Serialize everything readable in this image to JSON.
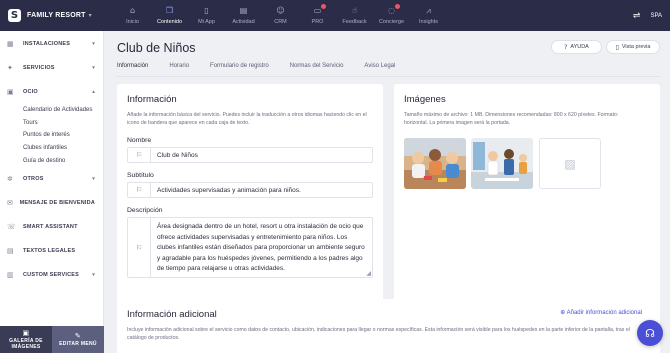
{
  "brand": {
    "name": "FAMILY RESORT",
    "logo_letter": "S"
  },
  "nav": [
    {
      "label": "Inicio",
      "icon": "home-icon",
      "glyph": "⌂",
      "badge": false,
      "active": false
    },
    {
      "label": "Contenido",
      "icon": "content-icon",
      "glyph": "❒",
      "badge": false,
      "active": true
    },
    {
      "label": "Mi App",
      "icon": "phone-icon",
      "glyph": "▯",
      "badge": false,
      "active": false
    },
    {
      "label": "Actividad",
      "icon": "activity-icon",
      "glyph": "▤",
      "badge": false,
      "active": false
    },
    {
      "label": "CRM",
      "icon": "users-icon",
      "glyph": "☺",
      "badge": false,
      "active": false
    },
    {
      "label": "PRO",
      "icon": "pro-icon",
      "glyph": "▭",
      "badge": true,
      "active": false
    },
    {
      "label": "Feedback",
      "icon": "thumbs-up-icon",
      "glyph": "☝",
      "badge": false,
      "active": false
    },
    {
      "label": "Concierge",
      "icon": "chat-icon",
      "glyph": "◌",
      "badge": true,
      "active": false
    },
    {
      "label": "Insights",
      "icon": "chart-icon",
      "glyph": "⩘",
      "badge": false,
      "active": false
    }
  ],
  "topright": {
    "language": "SPA",
    "icon": "translate-icon"
  },
  "sidebar": {
    "groups": [
      {
        "label": "INSTALACIONES",
        "icon": "building-icon",
        "glyph": "▦",
        "chev": "▾",
        "subs": []
      },
      {
        "label": "SERVICIOS",
        "icon": "services-icon",
        "glyph": "✦",
        "chev": "▾",
        "subs": []
      },
      {
        "label": "OCIO",
        "icon": "leisure-icon",
        "glyph": "▣",
        "chev": "▴",
        "subs": [
          "Calendario de Actividades",
          "Tours",
          "Puntos de interés",
          "Clubes infantiles",
          "Guía de destino"
        ]
      },
      {
        "label": "OTROS",
        "icon": "more-icon",
        "glyph": "✲",
        "chev": "▾",
        "subs": []
      },
      {
        "label": "MENSAJE DE BIENVENIDA",
        "icon": "message-icon",
        "glyph": "✉",
        "chev": "",
        "subs": []
      },
      {
        "label": "SMART ASSISTANT",
        "icon": "assistant-icon",
        "glyph": "☏",
        "chev": "",
        "subs": []
      },
      {
        "label": "TEXTOS LEGALES",
        "icon": "legal-icon",
        "glyph": "▤",
        "chev": "",
        "subs": []
      },
      {
        "label": "CUSTOM SERVICES",
        "icon": "custom-icon",
        "glyph": "▥",
        "chev": "▾",
        "subs": []
      }
    ],
    "bottom": {
      "gallery_line1": "GALERÍA DE",
      "gallery_line2": "IMÁGENES",
      "edit": "EDITAR MENÚ"
    }
  },
  "page": {
    "title": "Club de Niños",
    "help": "AYUDA",
    "preview": "Vista previa",
    "tabs": [
      "Información",
      "Horario",
      "Formulario de registro",
      "Normas del Servicio",
      "Aviso Legal"
    ],
    "active_tab": 0
  },
  "info": {
    "title": "Información",
    "desc": "Añade la información básica del servicio. Puedes incluir la traducción a otros idiomas haciendo clic en el icono de bandera que aparece en cada caja de texto.",
    "name_label": "Nombre",
    "name_value": "Club de Niños",
    "subtitle_label": "Subtítulo",
    "subtitle_value": "Actividades supervisadas y animación para niños.",
    "description_label": "Descripción",
    "description_value": "Área designada dentro de un hotel, resort u otra instalación de ocio que ofrece actividades supervisadas y entretenimiento para niños. Los clubes infantiles están diseñados para proporcionar un ambiente seguro y agradable para los huéspedes jóvenes, permitiendo a los padres algo de tiempo para relajarse u otras actividades."
  },
  "images": {
    "title": "Imágenes",
    "desc": "Tamaño máximo de archivo: 1 MB. Dimensiones recomendadas: 800 x 620 píxeles. Formato: horizontal. La primera imagen será la portada."
  },
  "additional": {
    "title": "Información adicional",
    "add_link": "Añadir información adicional",
    "desc": "Incluye información adicional sobre el servicio como datos de contacto, ubicación, indicaciones para llegar o normas específicas. Esta información será visible para los huéspedes en la parte inferior de la pantalla, tras el catálogo de productos."
  },
  "colors": {
    "topbar": "#2a2c48",
    "accent": "#4b4fd6",
    "badge": "#e8566a"
  }
}
